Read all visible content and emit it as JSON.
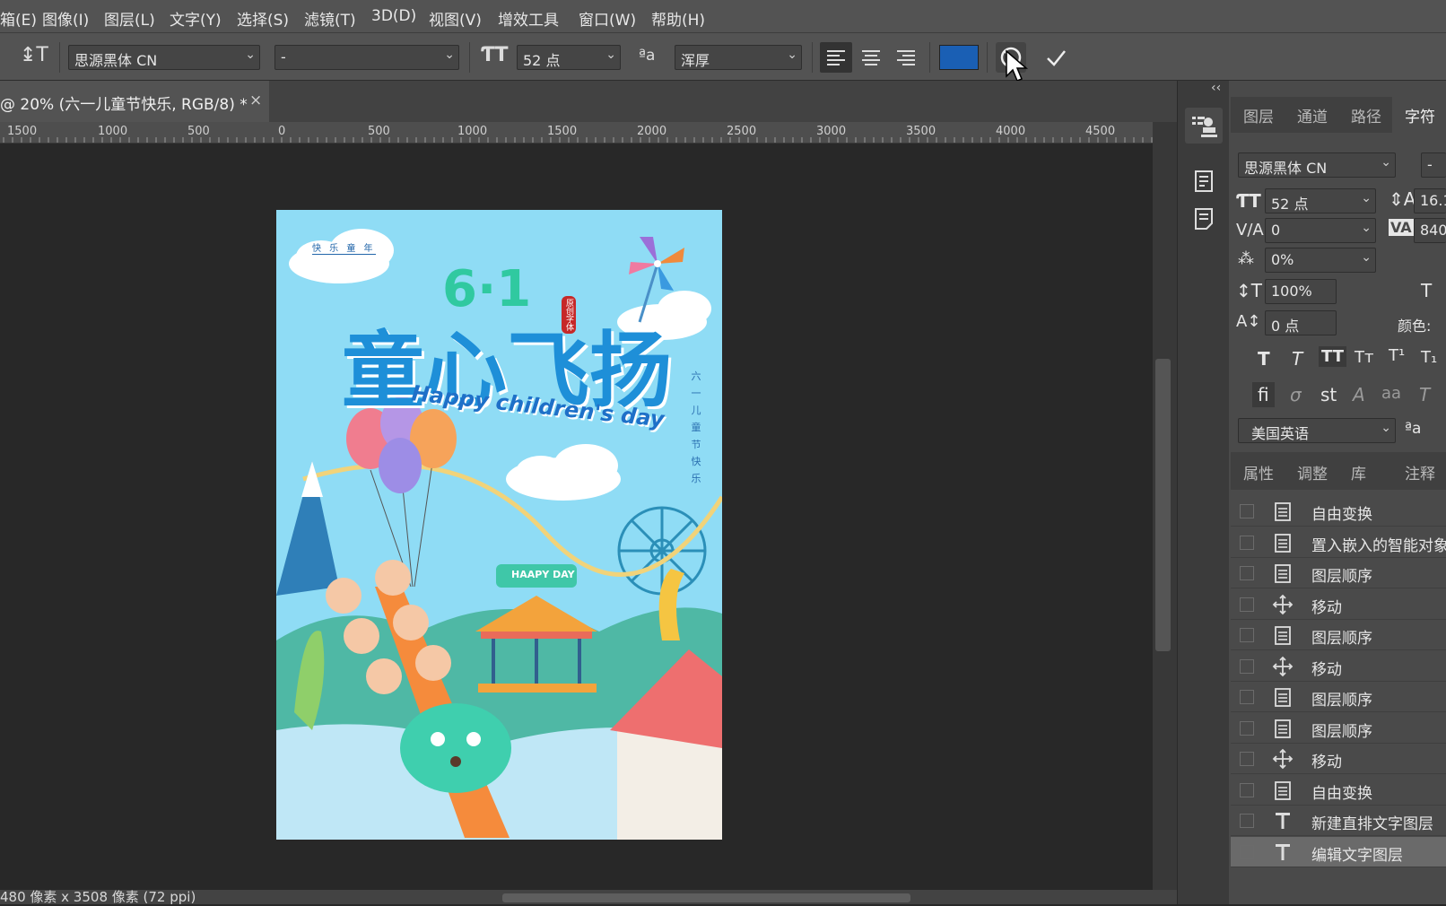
{
  "menu": [
    "箱(E)",
    "图像(I)",
    "图层(L)",
    "文字(Y)",
    "选择(S)",
    "滤镜(T)",
    "3D(D)",
    "视图(V)",
    "增效工具",
    "窗口(W)",
    "帮助(H)"
  ],
  "options": {
    "font_family": "思源黑体 CN",
    "font_style": "-",
    "font_size": "52 点",
    "aa_label": "ªa",
    "antialias": "浑厚",
    "text_color": "#1a5fb4"
  },
  "document": {
    "tab_title": "@ 20% (六一儿童节快乐, RGB/8) *",
    "close": "×",
    "ruler_labels": [
      "1500",
      "1000",
      "500",
      "0",
      "500",
      "1000",
      "1500",
      "2000",
      "2500",
      "3000",
      "3500",
      "4000",
      "4500"
    ],
    "status": "480 像素 x 3508 像素 (72 ppi)"
  },
  "poster": {
    "small_top": "快 乐 童 年",
    "big_title": "童心飞扬",
    "num": "6·1",
    "stamp": "原创字体",
    "subtitle": "Happy children's day",
    "vertical": [
      "六",
      "一",
      "儿",
      "童",
      "节",
      "快",
      "乐"
    ],
    "badge": "HAAPY DAY"
  },
  "panel": {
    "collapse": "‹‹",
    "tabs": [
      "图层",
      "通道",
      "路径",
      "字符"
    ],
    "character": {
      "font_family": "思源黑体 CN",
      "font_style": "-",
      "size": "52 点",
      "leading": "16.1",
      "kerning": "0",
      "tracking": "840",
      "scale_pct": "0%",
      "vscale": "100%",
      "baseline": "0 点",
      "color_label": "颜色:",
      "language": "美国英语",
      "aa": "ªa"
    },
    "bottom_tabs": [
      "属性",
      "调整",
      "库",
      "注释"
    ],
    "history": [
      {
        "icon": "doc",
        "label": "自由变换"
      },
      {
        "icon": "doc",
        "label": "置入嵌入的智能对象"
      },
      {
        "icon": "doc",
        "label": "图层顺序"
      },
      {
        "icon": "move",
        "label": "移动"
      },
      {
        "icon": "doc",
        "label": "图层顺序"
      },
      {
        "icon": "move",
        "label": "移动"
      },
      {
        "icon": "doc",
        "label": "图层顺序"
      },
      {
        "icon": "doc",
        "label": "图层顺序"
      },
      {
        "icon": "move",
        "label": "移动"
      },
      {
        "icon": "doc",
        "label": "自由变换"
      },
      {
        "icon": "text",
        "label": "新建直排文字图层"
      },
      {
        "icon": "text",
        "label": "编辑文字图层"
      }
    ]
  },
  "colors": {
    "accent": "#1a5fb4",
    "panel": "#4a4a4a",
    "canvas": "#282828"
  }
}
